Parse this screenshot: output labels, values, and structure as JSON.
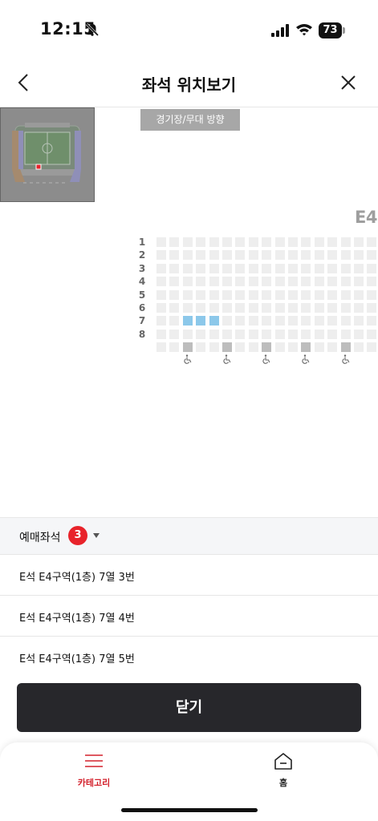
{
  "status_bar": {
    "time": "12:15",
    "battery": "73"
  },
  "header": {
    "title": "좌석 위치보기"
  },
  "map": {
    "stage_direction": "경기장/무대 방향",
    "section": "E4"
  },
  "seat_map": {
    "rows": [
      "1",
      "2",
      "3",
      "4",
      "5",
      "6",
      "7",
      "8"
    ],
    "seats_per_row": 17,
    "selected_row": "7",
    "selected_seats": [
      3,
      4,
      5
    ],
    "wheelchair_seats": [
      3,
      6,
      9,
      12,
      15
    ],
    "colors": {
      "seat": "#eeeeee",
      "selected": "#8cc8ea",
      "wheelchair": "#bdbdbd"
    }
  },
  "reservation": {
    "label": "예매좌석",
    "count": "3",
    "items": [
      "E석 E4구역(1층) 7열 3번",
      "E석 E4구역(1층) 7열 4번",
      "E석 E4구역(1층) 7열 5번"
    ]
  },
  "close_button": "닫기",
  "nav": {
    "category": "카테고리",
    "home": "홈",
    "accent": "#d3212c"
  }
}
